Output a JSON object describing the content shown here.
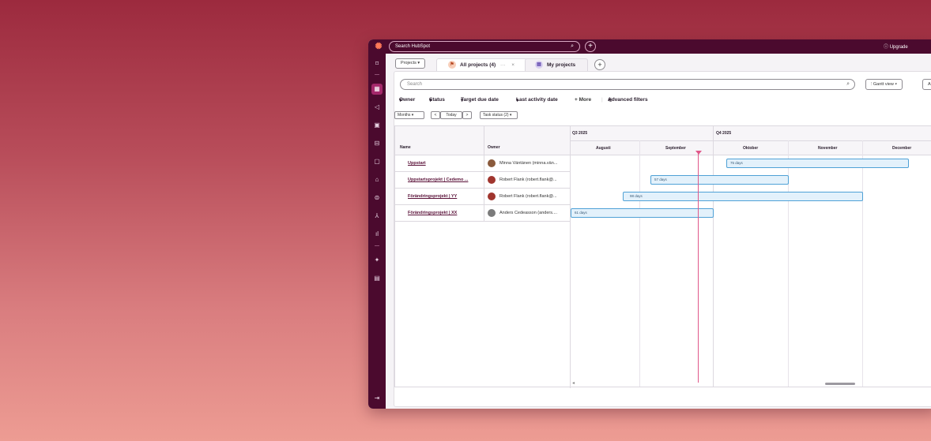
{
  "topbar": {
    "search_placeholder": "Search HubSpot",
    "search_icon": "search-icon",
    "plus_label": "+",
    "upgrade_label": "Upgrade",
    "upgrade_icon": "upgrade-icon"
  },
  "sidebar": {
    "items": [
      {
        "icon": "bookmark-icon",
        "glyph": "⌑"
      },
      {
        "icon": "records-icon",
        "glyph": "▦"
      },
      {
        "icon": "megaphone-icon",
        "glyph": "◁"
      },
      {
        "icon": "sales-icon",
        "glyph": "▣"
      },
      {
        "icon": "commerce-icon",
        "glyph": "⊟"
      },
      {
        "icon": "service-icon",
        "glyph": "▢"
      },
      {
        "icon": "content-icon",
        "glyph": "⌂"
      },
      {
        "icon": "data-icon",
        "glyph": "⊜"
      },
      {
        "icon": "automation-icon",
        "glyph": "⅄"
      },
      {
        "icon": "reporting-icon",
        "glyph": "ıl"
      },
      {
        "icon": "apps-icon",
        "glyph": "✦"
      },
      {
        "icon": "library-icon",
        "glyph": "▤"
      },
      {
        "icon": "expand-icon",
        "glyph": "⇥"
      }
    ]
  },
  "tabs": {
    "projects_label": "Projects",
    "all_projects_label": "All projects (4)",
    "all_projects_more": "···",
    "all_projects_close": "×",
    "my_projects_label": "My projects",
    "add_tab": "+"
  },
  "search": {
    "placeholder": "Search"
  },
  "view": {
    "gantt_label": "Gantt view",
    "all_label": "All P"
  },
  "filters": {
    "owner": "Owner",
    "status": "Status",
    "target_due_date": "Target due date",
    "last_activity_date": "Last activity date",
    "more": "+ More",
    "advanced": "Advanced filters"
  },
  "controls": {
    "zoom": "Months",
    "prev": "<",
    "today": "Today",
    "next": ">",
    "task_status": "Task status (2)"
  },
  "table": {
    "col_name": "Name",
    "col_owner": "Owner",
    "quarters": [
      "Q3 2025",
      "Q4 2025"
    ],
    "months": [
      "Augusti",
      "September",
      "Oktober",
      "November",
      "December"
    ],
    "rows": [
      {
        "name": "Uppstart",
        "owner": "Minna Väntänen (minna.vän...",
        "duration": "75 days",
        "avatar_color": "#8a5a3c"
      },
      {
        "name": "Uppstartsprojekt | Cedemo ...",
        "owner": "Robert Flank (robert.flank@...",
        "duration": "57 days",
        "avatar_color": "#a0352e"
      },
      {
        "name": "Förändringsprojekt | YY",
        "owner": "Robert Flank (robert.flank@...",
        "duration": "98 days",
        "avatar_color": "#a0352e"
      },
      {
        "name": "Förändringsprojekt | XX",
        "owner": "Anders Cedeasson (anders....",
        "duration": "61 days",
        "avatar_color": "#7b7b7b"
      }
    ]
  },
  "colors": {
    "topbar": "#4b0a2e",
    "accent": "#a4286a",
    "today_line": "#e0588a",
    "bar_fill": "#e3f1fb",
    "bar_border": "#4fa1d6"
  }
}
